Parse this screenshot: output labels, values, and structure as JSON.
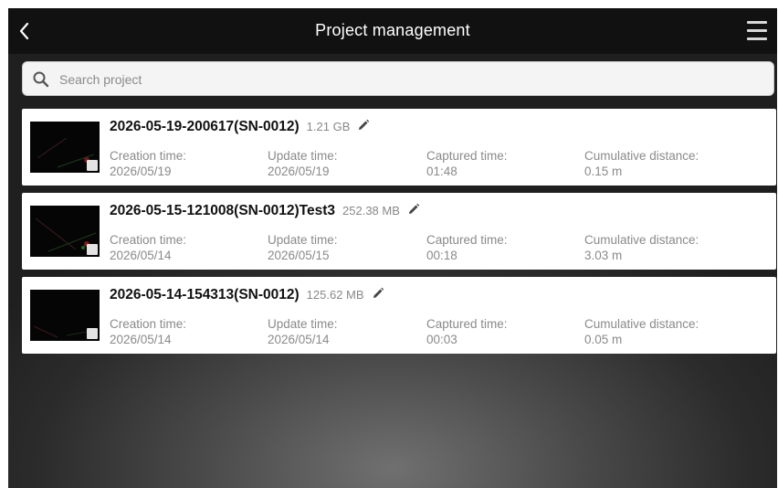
{
  "header": {
    "title": "Project management",
    "back_icon": "chevron-left-icon",
    "menu_icon": "hamburger-menu-icon"
  },
  "search": {
    "placeholder": "Search project",
    "icon": "search-icon"
  },
  "labels": {
    "creation": "Creation time:",
    "update": "Update time:",
    "captured": "Captured time:",
    "distance": "Cumulative distance:"
  },
  "projects": [
    {
      "name": "2026-05-19-200617(SN-0012)",
      "size": "1.21 GB",
      "creation_time": "2026/05/19",
      "update_time": "2026/05/19",
      "captured_time": "01:48",
      "cumulative_distance": "0.15 m"
    },
    {
      "name": "2026-05-15-121008(SN-0012)Test3",
      "size": "252.38 MB",
      "creation_time": "2026/05/14",
      "update_time": "2026/05/15",
      "captured_time": "00:18",
      "cumulative_distance": "3.03 m"
    },
    {
      "name": "2026-05-14-154313(SN-0012)",
      "size": "125.62 MB",
      "creation_time": "2026/05/14",
      "update_time": "2026/05/14",
      "captured_time": "00:03",
      "cumulative_distance": "0.05 m"
    }
  ],
  "colors": {
    "topbar": "#111111",
    "card": "#ffffff",
    "muted_text": "#8a8a8a"
  }
}
